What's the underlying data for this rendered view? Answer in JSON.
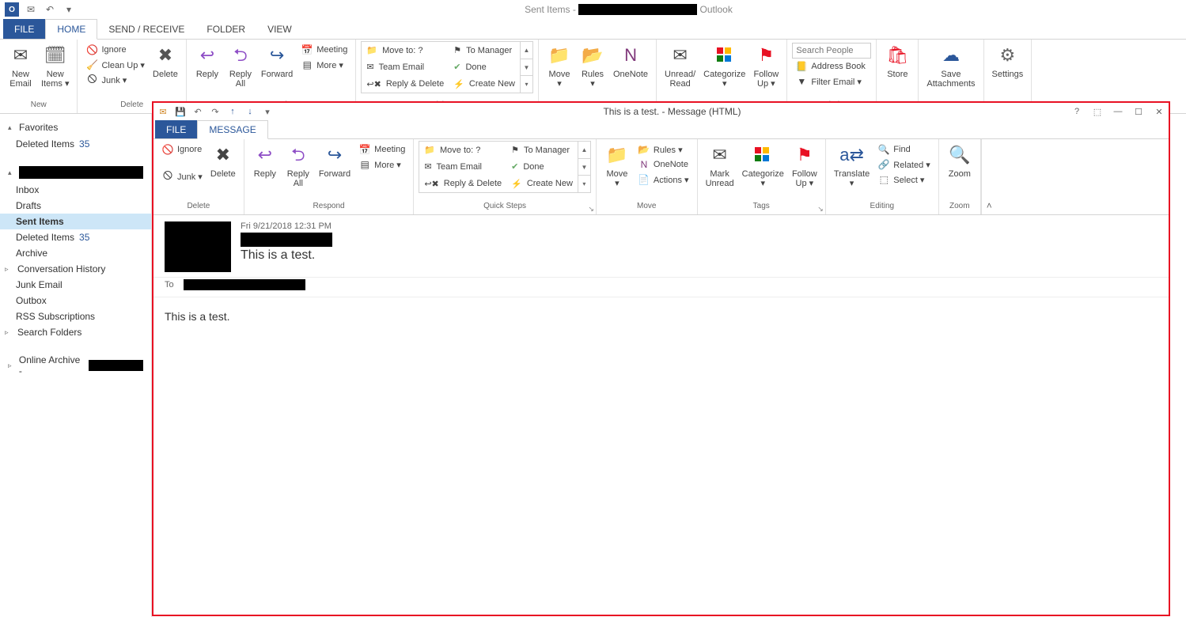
{
  "app": {
    "title_prefix": "Sent Items - ",
    "title_suffix": " Outlook"
  },
  "main_tabs": {
    "file": "FILE",
    "home": "HOME",
    "sendreceive": "SEND / RECEIVE",
    "folder": "FOLDER",
    "view": "VIEW"
  },
  "ribbon_main": {
    "new": {
      "email": "New\nEmail",
      "items": "New\nItems ▾",
      "label": "New"
    },
    "delete": {
      "ignore": "Ignore",
      "cleanup": "Clean Up ▾",
      "junk": "Junk ▾",
      "delete": "Delete",
      "label": "Delete"
    },
    "respond": {
      "reply": "Reply",
      "replyall": "Reply\nAll",
      "forward": "Forward",
      "meeting": "Meeting",
      "more": "More ▾"
    },
    "quicksteps": {
      "moveto": "Move to: ?",
      "tomanager": "To Manager",
      "teamemail": "Team Email",
      "done": "Done",
      "replydelete": "Reply & Delete",
      "createnew": "Create New"
    },
    "move": {
      "move": "Move\n▾",
      "rules": "Rules\n▾",
      "onenote": "OneNote"
    },
    "tags": {
      "unread": "Unread/\nRead",
      "categorize": "Categorize\n▾",
      "followup": "Follow\nUp ▾"
    },
    "find": {
      "search_ph": "Search People",
      "addressbook": "Address Book",
      "filter": "Filter Email ▾"
    },
    "store": "Store",
    "save": "Save\nAttachments",
    "settings": "Settings"
  },
  "folders": {
    "favorites": "Favorites",
    "deleted_a": "Deleted Items",
    "deleted_a_count": "35",
    "inbox": "Inbox",
    "drafts": "Drafts",
    "sent": "Sent Items",
    "deleted_b": "Deleted Items",
    "deleted_b_count": "35",
    "archive": "Archive",
    "convhist": "Conversation History",
    "junk": "Junk Email",
    "outbox": "Outbox",
    "rss": "RSS Subscriptions",
    "searchf": "Search Folders",
    "online": "Online Archive - "
  },
  "msgwin": {
    "title": "This is a test. - Message (HTML)",
    "tabs": {
      "file": "FILE",
      "message": "MESSAGE"
    },
    "ribbon": {
      "delete": {
        "ignore": "Ignore",
        "junk": "Junk ▾",
        "delete": "Delete",
        "label": "Delete"
      },
      "respond": {
        "reply": "Reply",
        "replyall": "Reply\nAll",
        "forward": "Forward",
        "meeting": "Meeting",
        "more": "More ▾",
        "label": "Respond"
      },
      "quicksteps": {
        "moveto": "Move to: ?",
        "tomanager": "To Manager",
        "teamemail": "Team Email",
        "done": "Done",
        "replydelete": "Reply & Delete",
        "createnew": "Create New",
        "label": "Quick Steps"
      },
      "move": {
        "move": "Move\n▾",
        "rules": "Rules ▾",
        "onenote": "OneNote",
        "actions": "Actions ▾",
        "label": "Move"
      },
      "tags": {
        "unread": "Mark\nUnread",
        "categorize": "Categorize\n▾",
        "followup": "Follow\nUp ▾",
        "label": "Tags"
      },
      "editing": {
        "translate": "Translate\n▾",
        "find": "Find",
        "related": "Related ▾",
        "select": "Select ▾",
        "label": "Editing"
      },
      "zoom": {
        "zoom": "Zoom",
        "label": "Zoom"
      }
    },
    "meta": {
      "date": "Fri 9/21/2018 12:31 PM",
      "subject": "This is a test.",
      "to_label": "To"
    },
    "body": "This is a test."
  }
}
